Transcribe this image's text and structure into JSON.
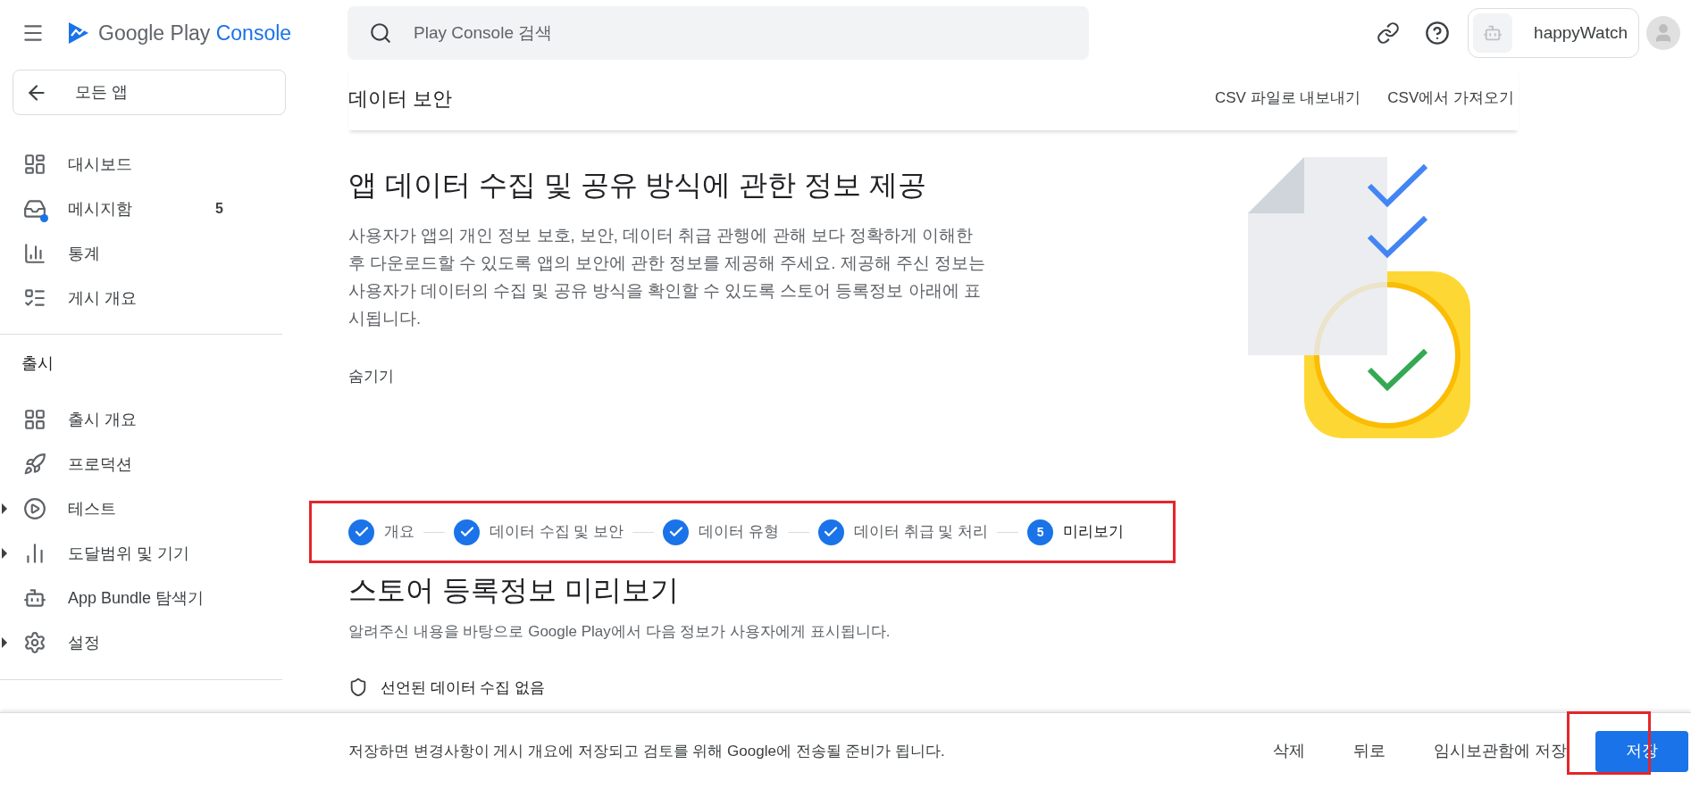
{
  "app_bar": {
    "logo": {
      "brand": "Google Play",
      "product": "Console"
    },
    "search": {
      "placeholder": "Play Console 검색"
    },
    "app_name": "happyWatch"
  },
  "sidebar": {
    "back_button": "모든 앱",
    "groups": [
      {
        "items": [
          {
            "label": "대시보드",
            "unread": false,
            "expandable": false
          },
          {
            "label": "메시지함",
            "count": "5",
            "unread": true,
            "expandable": false
          },
          {
            "label": "통계",
            "unread": false,
            "expandable": false
          },
          {
            "label": "게시 개요",
            "unread": false,
            "expandable": false
          }
        ]
      },
      {
        "heading": "출시",
        "items": [
          {
            "label": "출시 개요",
            "unread": false,
            "expandable": false
          },
          {
            "label": "프로덕션",
            "unread": false,
            "expandable": false
          },
          {
            "label": "테스트",
            "unread": false,
            "expandable": true
          },
          {
            "label": "도달범위 및 기기",
            "unread": false,
            "expandable": true
          },
          {
            "label": "App Bundle 탐색기",
            "unread": false,
            "expandable": false
          },
          {
            "label": "설정",
            "unread": false,
            "expandable": true
          }
        ]
      }
    ]
  },
  "page_header": {
    "title": "데이터 보안",
    "actions": [
      "CSV 파일로 내보내기",
      "CSV에서 가져오기"
    ]
  },
  "intro": {
    "title": "앱 데이터 수집 및 공유 방식에 관한 정보 제공",
    "body": "사용자가 앱의 개인 정보 보호, 보안, 데이터 취급 관행에 관해 보다 정확하게 이해한 후 다운로드할 수 있도록 앱의 보안에 관한 정보를 제공해 주세요. 제공해 주신 정보는 사용자가 데이터의 수집 및 공유 방식을 확인할 수 있도록 스토어 등록정보 아래에 표시됩니다.",
    "toggle": "숨기기"
  },
  "stepper": {
    "highlighted": true,
    "steps": [
      {
        "label": "개요",
        "completed": true
      },
      {
        "label": "데이터 수집 및 보안",
        "completed": true
      },
      {
        "label": "데이터 유형",
        "completed": true
      },
      {
        "label": "데이터 취급 및 처리",
        "completed": true
      },
      {
        "label": "미리보기",
        "completed": false,
        "number": "5"
      }
    ]
  },
  "preview": {
    "title": "스토어 등록정보 미리보기",
    "subtitle": "알려주신 내용을 바탕으로 Google Play에서 다음 정보가 사용자에게 표시됩니다.",
    "first_item": "선언된 데이터 수집 없음"
  },
  "bottom_bar": {
    "message": "저장하면 변경사항이 게시 개요에 저장되고 검토를 위해 Google에 전송될 준비가 됩니다.",
    "buttons": [
      {
        "label": "삭제",
        "kind": "text",
        "highlighted": false
      },
      {
        "label": "뒤로",
        "kind": "text",
        "highlighted": false
      },
      {
        "label": "임시보관함에 저장",
        "kind": "text",
        "highlighted": false
      },
      {
        "label": "저장",
        "kind": "primary",
        "highlighted": true
      }
    ]
  }
}
